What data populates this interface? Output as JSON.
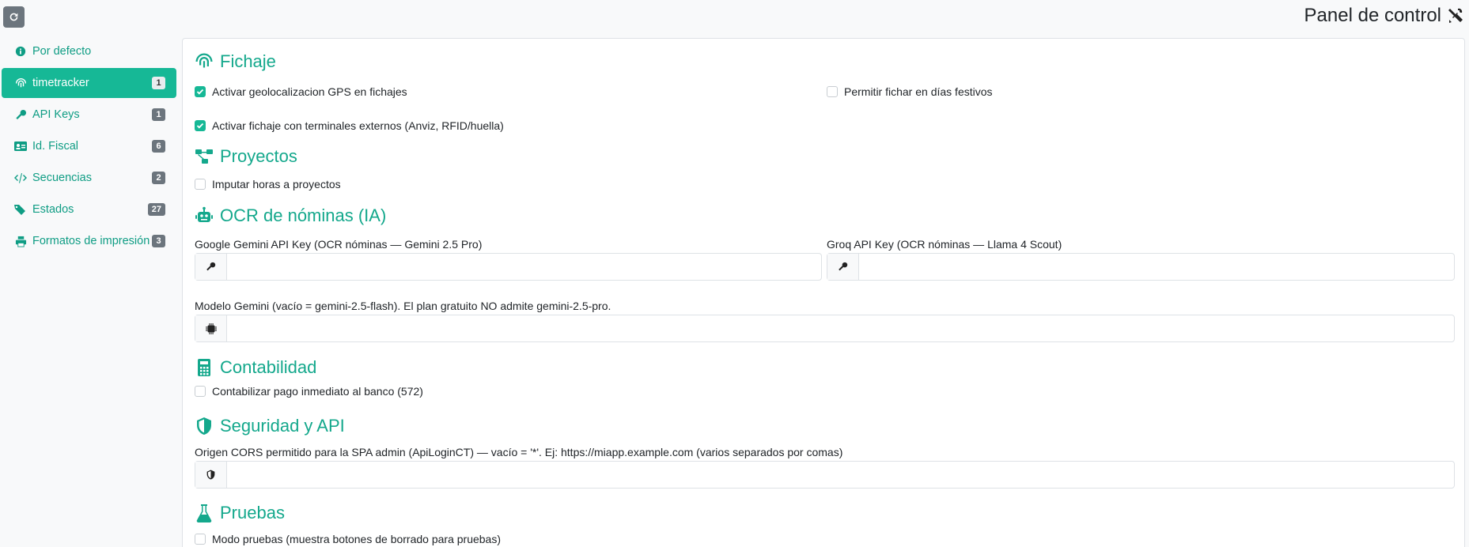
{
  "header": {
    "title": "Panel de control",
    "refresh_icon": "refresh-icon",
    "tools_icon": "tools-icon"
  },
  "sidebar": {
    "items": [
      {
        "label": "Por defecto",
        "icon": "info-icon",
        "badge": ""
      },
      {
        "label": "timetracker",
        "icon": "fingerprint-icon",
        "badge": "1",
        "active": true
      },
      {
        "label": "API Keys",
        "icon": "key-icon",
        "badge": "1"
      },
      {
        "label": "Id. Fiscal",
        "icon": "id-card-icon",
        "badge": "6"
      },
      {
        "label": "Secuencias",
        "icon": "code-icon",
        "badge": "2"
      },
      {
        "label": "Estados",
        "icon": "tags-icon",
        "badge": "27"
      },
      {
        "label": "Formatos de impresión",
        "icon": "printer-icon",
        "badge": "3"
      }
    ]
  },
  "sections": {
    "fichaje": {
      "title": "Fichaje",
      "gps": {
        "label": "Activar geolocalizacion GPS en fichajes",
        "checked": true
      },
      "festivos": {
        "label": "Permitir fichar en días festivos",
        "checked": false
      },
      "terminales": {
        "label": "Activar fichaje con terminales externos (Anviz, RFID/huella)",
        "checked": true
      }
    },
    "proyectos": {
      "title": "Proyectos",
      "imputar": {
        "label": "Imputar horas a proyectos",
        "checked": false
      }
    },
    "ocr": {
      "title": "OCR de nóminas (IA)",
      "gemini_key_label": "Google Gemini API Key (OCR nóminas — Gemini 2.5 Pro)",
      "gemini_key_value": "",
      "groq_key_label": "Groq API Key (OCR nóminas — Llama 4 Scout)",
      "groq_key_value": "",
      "modelo_label": "Modelo Gemini (vacío = gemini-2.5-flash). El plan gratuito NO admite gemini-2.5-pro.",
      "modelo_value": ""
    },
    "contabilidad": {
      "title": "Contabilidad",
      "pago": {
        "label": "Contabilizar pago inmediato al banco (572)",
        "checked": false
      }
    },
    "seguridad": {
      "title": "Seguridad y API",
      "cors_label": "Origen CORS permitido para la SPA admin (ApiLoginCT) — vacío = '*'. Ej: https://miapp.example.com (varios separados por comas)",
      "cors_value": ""
    },
    "pruebas": {
      "title": "Pruebas",
      "modo": {
        "label": "Modo pruebas (muestra botones de borrado para pruebas)",
        "checked": false
      }
    }
  },
  "colors": {
    "accent": "#16b896",
    "accent_text": "#14a88c",
    "badge": "#6c757d"
  }
}
